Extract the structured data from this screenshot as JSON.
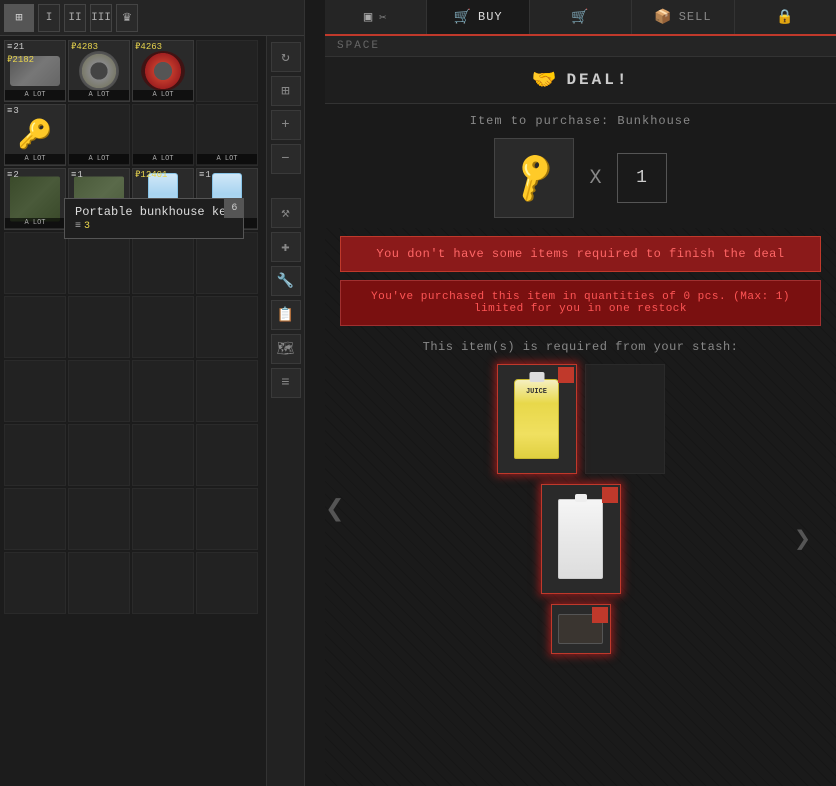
{
  "left_panel": {
    "tabs": [
      "grid",
      "I",
      "II",
      "III",
      "crown"
    ],
    "rows": [
      [
        {
          "count": "21",
          "price": "2182",
          "type": "pills",
          "label": "A LOT"
        },
        {
          "count": null,
          "price": "4283",
          "type": "tape",
          "label": "A LOT"
        },
        {
          "count": null,
          "price": "4263",
          "type": "wire",
          "label": "A LOT"
        },
        {
          "count": null,
          "price": null,
          "type": "empty",
          "label": ""
        }
      ],
      [
        {
          "count": "3",
          "price": null,
          "type": "key",
          "label": "A LOT"
        },
        {
          "count": null,
          "price": null,
          "type": "empty",
          "label": "A LOT"
        },
        {
          "count": null,
          "price": null,
          "type": "empty",
          "label": "A LOT"
        },
        {
          "count": null,
          "price": null,
          "type": "empty",
          "label": "A LOT"
        }
      ],
      [
        {
          "count": "2",
          "price": null,
          "type": "cloth",
          "label": "A LOT"
        },
        {
          "count": "1",
          "price": null,
          "type": "cloth2",
          "label": "A LOT"
        },
        {
          "count": null,
          "price": "12401",
          "type": "water",
          "label": "A LOT"
        },
        {
          "count": "1",
          "price": null,
          "type": "water",
          "label": "A LOT"
        }
      ]
    ],
    "tooltip": {
      "title": "Portable bunkhouse key",
      "count_icon": "≡",
      "count": "3",
      "corner_num": "6"
    }
  },
  "right_panel": {
    "nav_tabs": [
      {
        "label": "",
        "icon": "▣",
        "type": "grid"
      },
      {
        "label": "BUY",
        "icon": "🛒"
      },
      {
        "label": "",
        "icon": "🛒"
      },
      {
        "label": "SELL",
        "icon": "📦"
      },
      {
        "label": "",
        "icon": "🔒"
      }
    ],
    "space_label": "SPACE",
    "deal_title": "DEAL!",
    "deal_icon": "🤝",
    "purchase_label": "Item to purchase: Bunkhouse",
    "quantity": "1",
    "error_message": "You don't have some items required to finish the deal",
    "warning_message": "You've purchased this item in quantities of 0 pcs. (Max: 1) limited for you in one restock",
    "required_label": "This item(s) is required from your stash:",
    "required_items": [
      {
        "type": "juice",
        "has_red": true
      },
      {
        "type": "milk",
        "has_red": true
      },
      {
        "type": "small",
        "has_red": true
      }
    ]
  }
}
